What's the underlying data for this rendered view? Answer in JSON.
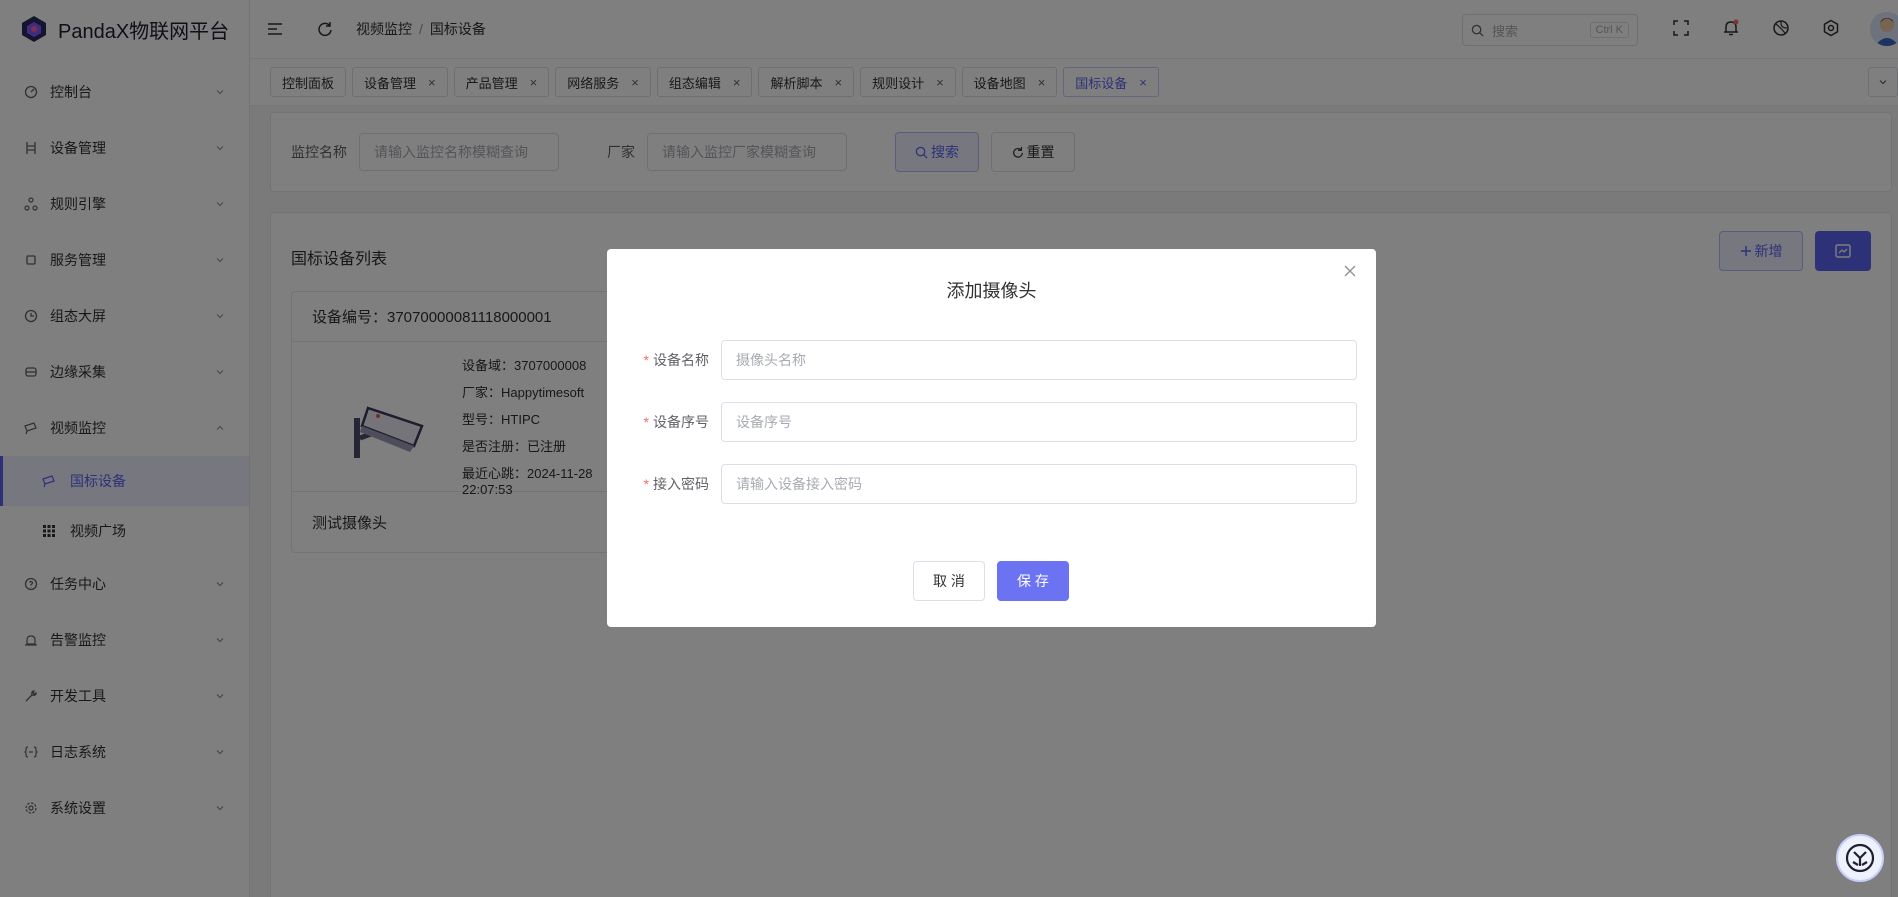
{
  "app": {
    "title": "PandaX物联网平台"
  },
  "colors": {
    "accent": "#5b62f0",
    "required": "#f56c6c"
  },
  "sidebar": {
    "items": [
      {
        "label": "控制台",
        "icon": "dashboard-icon"
      },
      {
        "label": "设备管理",
        "icon": "device-icon"
      },
      {
        "label": "规则引擎",
        "icon": "rules-icon"
      },
      {
        "label": "服务管理",
        "icon": "service-icon"
      },
      {
        "label": "组态大屏",
        "icon": "screen-icon"
      },
      {
        "label": "边缘采集",
        "icon": "edge-icon"
      },
      {
        "label": "视频监控",
        "icon": "video-icon"
      }
    ],
    "sub_items": [
      {
        "label": "国标设备",
        "icon": "camera-icon"
      },
      {
        "label": "视频广场",
        "icon": "grid-icon"
      }
    ],
    "items_after": [
      {
        "label": "任务中心",
        "icon": "task-icon"
      },
      {
        "label": "告警监控",
        "icon": "alarm-icon"
      },
      {
        "label": "开发工具",
        "icon": "tool-icon"
      },
      {
        "label": "日志系统",
        "icon": "log-icon"
      },
      {
        "label": "系统设置",
        "icon": "settings-icon"
      }
    ]
  },
  "header": {
    "breadcrumb": [
      "视频监控",
      "国标设备"
    ],
    "breadcrumb_sep": "/",
    "search_placeholder": "搜索",
    "search_shortcut": "Ctrl K"
  },
  "tabs": [
    "控制面板",
    "设备管理",
    "产品管理",
    "网络服务",
    "组态编辑",
    "解析脚本",
    "规则设计",
    "设备地图",
    "国标设备"
  ],
  "tab_close": "×",
  "search_panel": {
    "name_label": "监控名称",
    "name_placeholder": "请输入监控名称模糊查询",
    "vendor_label": "厂家",
    "vendor_placeholder": "请输入监控厂家模糊查询",
    "search_button": "搜索",
    "reset_button": "重置"
  },
  "list": {
    "title": "国标设备列表",
    "add_button": "新增",
    "card": {
      "device_no": "设备编号：37070000081118000001",
      "domain": "设备域：3707000008",
      "vendor": "厂家：Happytimesoft",
      "model": "型号：HTIPC",
      "registered": "是否注册：已注册",
      "heartbeat_1": "最近心跳：2024-11-28",
      "heartbeat_2": "22:07:53",
      "name": "测试摄像头"
    }
  },
  "dialog": {
    "title": "添加摄像头",
    "fields": [
      {
        "label": "设备名称",
        "placeholder": "摄像头名称"
      },
      {
        "label": "设备序号",
        "placeholder": "设备序号"
      },
      {
        "label": "接入密码",
        "placeholder": "请输入设备接入密码"
      }
    ],
    "required_mark": "*",
    "cancel": "取 消",
    "save": "保 存"
  }
}
